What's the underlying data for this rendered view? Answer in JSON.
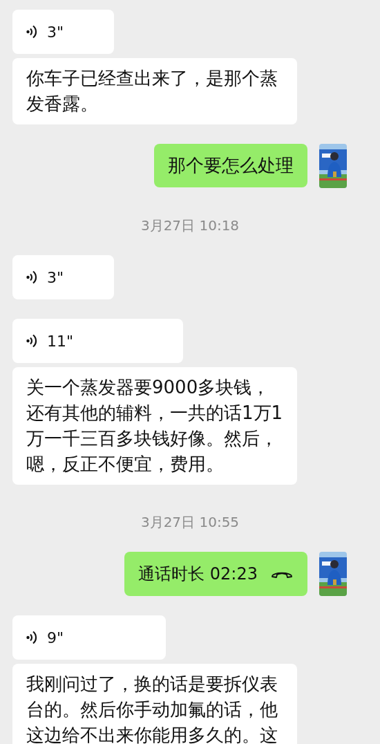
{
  "messages": [
    {
      "kind": "incoming",
      "bubbles": [
        {
          "kind": "voice",
          "duration": "3\""
        },
        {
          "kind": "text",
          "text": "你车子已经查出来了，是那个蒸发香露。"
        }
      ]
    },
    {
      "kind": "outgoing",
      "bubbles": [
        {
          "kind": "text",
          "text": "那个要怎么处理"
        }
      ]
    },
    {
      "kind": "time",
      "text": "3月27日 10:18"
    },
    {
      "kind": "incoming",
      "bubbles": [
        {
          "kind": "voice",
          "duration": "3\""
        }
      ]
    },
    {
      "kind": "incoming",
      "bubbles": [
        {
          "kind": "voice",
          "duration": "11\""
        },
        {
          "kind": "text",
          "text": "关一个蒸发器要9000多块钱，还有其他的辅料，一共的话1万1万一千三百多块钱好像。然后，嗯，反正不便宜，费用。"
        }
      ]
    },
    {
      "kind": "time",
      "text": "3月27日 10:55"
    },
    {
      "kind": "outgoing",
      "bubbles": [
        {
          "kind": "call",
          "text": "通话时长 02:23"
        }
      ]
    },
    {
      "kind": "incoming",
      "bubbles": [
        {
          "kind": "voice",
          "duration": "9\""
        },
        {
          "kind": "text",
          "text": "我刚问过了，换的话是要拆仪表台的。然后你手动加氟的话，他这边给不出来你能用多久的。这"
        }
      ]
    }
  ]
}
